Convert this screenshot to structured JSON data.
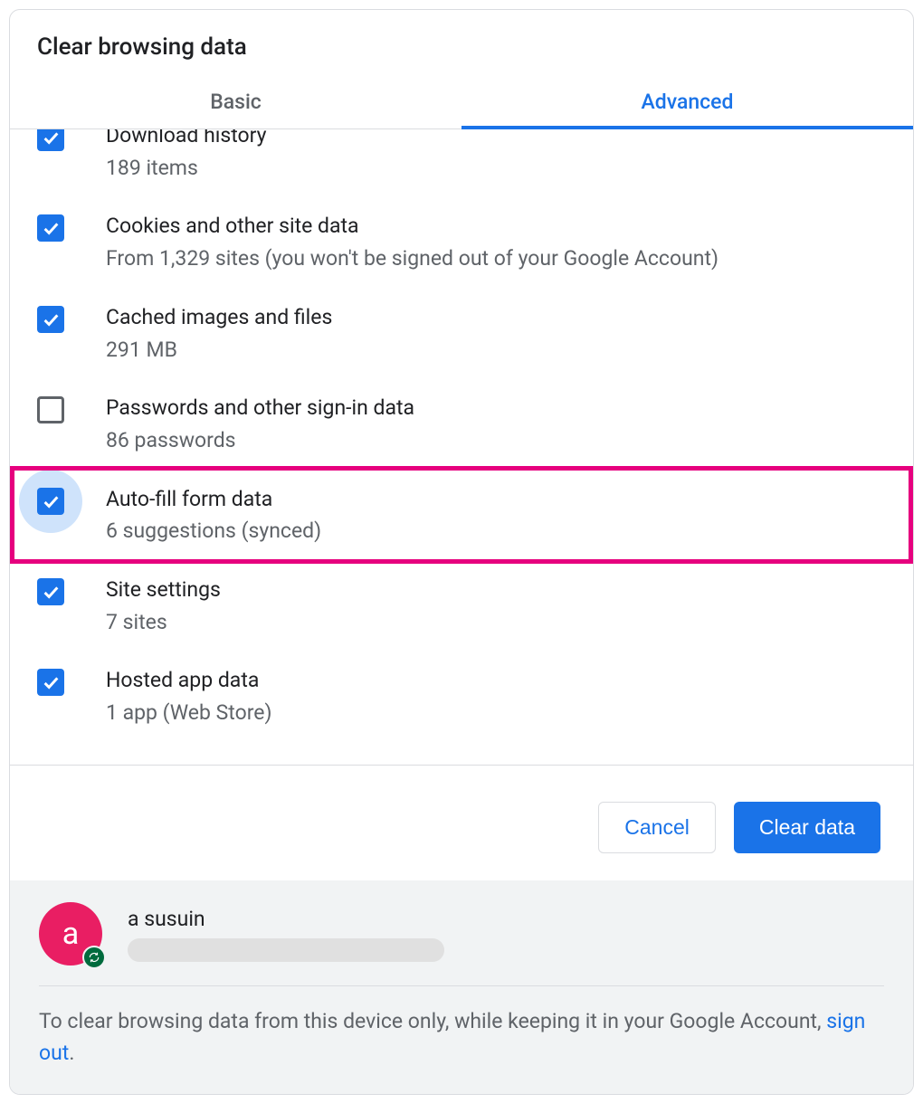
{
  "dialog": {
    "title": "Clear browsing data",
    "tabs": [
      {
        "label": "Basic",
        "active": false
      },
      {
        "label": "Advanced",
        "active": true
      }
    ],
    "items": [
      {
        "title": "Download history",
        "sub": "189 items",
        "checked": true,
        "highlighted": false
      },
      {
        "title": "Cookies and other site data",
        "sub": "From 1,329 sites (you won't be signed out of your Google Account)",
        "checked": true,
        "highlighted": false
      },
      {
        "title": "Cached images and files",
        "sub": "291 MB",
        "checked": true,
        "highlighted": false
      },
      {
        "title": "Passwords and other sign-in data",
        "sub": "86 passwords",
        "checked": false,
        "highlighted": false
      },
      {
        "title": "Auto-fill form data",
        "sub": "6 suggestions (synced)",
        "checked": true,
        "highlighted": true
      },
      {
        "title": "Site settings",
        "sub": "7 sites",
        "checked": true,
        "highlighted": false
      },
      {
        "title": "Hosted app data",
        "sub": "1 app (Web Store)",
        "checked": true,
        "highlighted": false
      }
    ],
    "actions": {
      "cancel": "Cancel",
      "confirm": "Clear data"
    },
    "account": {
      "avatar_letter": "a",
      "name": "a susuin"
    },
    "footer_note_pre": "To clear browsing data from this device only, while keeping it in your Google Account, ",
    "footer_link": "sign out",
    "footer_note_post": "."
  },
  "colors": {
    "accent": "#1a73e8",
    "highlight": "#e6007e"
  }
}
